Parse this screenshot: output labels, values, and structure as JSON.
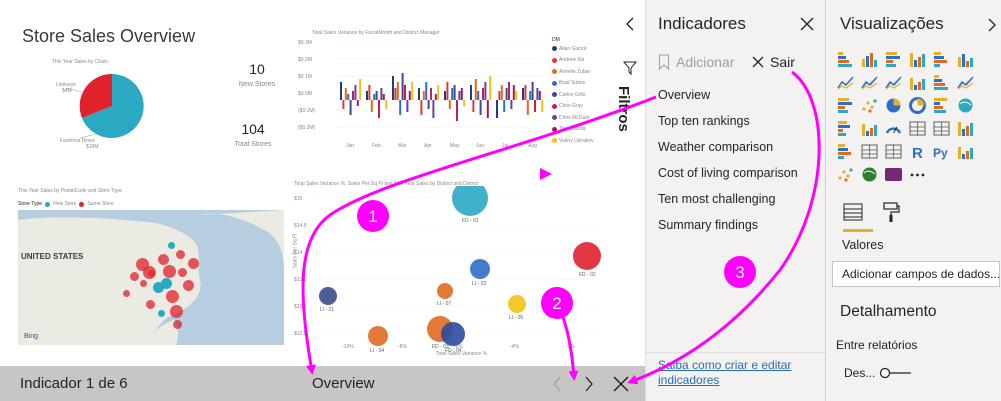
{
  "report": {
    "title": "Store Sales Overview",
    "pie_title": "This Year Sales by Chain",
    "pie_label_a": "Lindseys",
    "pie_label_a_value": "$4M",
    "pie_label_b": "Fashions Direct",
    "pie_label_b_value": "$16M",
    "kpi_new_stores_value": "10",
    "kpi_new_stores_label": "New Stores",
    "kpi_total_stores_value": "104",
    "kpi_total_stores_label": "Total Stores",
    "bar_title": "Total Sales Variance by FiscalMonth and District Manager",
    "bar_y_ticks": [
      "$0.3M",
      "$0.2M",
      "$0.1M",
      "$0.0M",
      "($0.1M)",
      "($0.2M)"
    ],
    "bar_x_ticks": [
      "Jan",
      "Feb",
      "Mar",
      "Apr",
      "May",
      "Jun",
      "Jul",
      "Aug"
    ],
    "legend_header": "DM",
    "legend_items": [
      {
        "name": "Allan Guinot",
        "color": "#1f3d7a"
      },
      {
        "name": "Andrew Ma",
        "color": "#e0393b"
      },
      {
        "name": "Annelie Zubar",
        "color": "#e06a20"
      },
      {
        "name": "Brad Sutton",
        "color": "#2c6fc9"
      },
      {
        "name": "Carlos Grilo",
        "color": "#3f4a8a"
      },
      {
        "name": "Chris Gray",
        "color": "#c41e58"
      },
      {
        "name": "Chris McGurk",
        "color": "#6b3fa0"
      },
      {
        "name": "Tina Lassila",
        "color": "#9b1e5a"
      },
      {
        "name": "Valery Ushakov",
        "color": "#f2c211"
      }
    ],
    "map_title": "This Year Sales by PostalCode and Store Type",
    "map_legend_label": "Store Type",
    "map_legend_new": "New Store",
    "map_legend_same": "Same Store",
    "map_country_label": "UNITED STATES",
    "map_bing": "Bing",
    "scatter_title": "Total Sales Variance %, Sales Per Sq Ft and This Year Sales by District and District",
    "scatter_x_label": "Total Sales Variance %",
    "scatter_y_label": "Sales Per Sq Ft",
    "scatter_y_ticks": [
      "$15",
      "$14.5",
      "$14",
      "$13.5",
      "$13",
      "$12.5"
    ],
    "scatter_x_ticks": [
      "-10%",
      "-8%",
      "-6%",
      "-4%",
      "-2%",
      "0%"
    ],
    "scatter_points": [
      "FD - 01",
      "FD - 02",
      "LI - 03",
      "LI - 07",
      "LI - 01",
      "LI - 05",
      "LI - 04",
      "FD - 03",
      "FD - 04"
    ]
  },
  "bookmark_bar": {
    "counter": "Indicador 1 de 6",
    "current": "Overview"
  },
  "filters": {
    "label": "Filtros"
  },
  "bookmarks_pane": {
    "title": "Indicadores",
    "add_label": "Adicionar",
    "exit_label": "Sair",
    "items": [
      "Overview",
      "Top ten rankings",
      "Weather comparison",
      "Cost of living comparison",
      "Ten most challenging",
      "Summary findings"
    ],
    "learn_link": "Saiba como criar e editar indicadores"
  },
  "viz_pane": {
    "title": "Visualizações",
    "values_label": "Valores",
    "add_fields_placeholder": "Adicionar campos de dados...",
    "drillthrough_title": "Detalhamento",
    "cross_report_label": "Entre relatórios",
    "toggle_label": "Des..."
  },
  "callouts": [
    "1",
    "2",
    "3"
  ],
  "colors": {
    "accent": "#ff00ff",
    "pane_bg": "#f3f2f1",
    "bookmark_bar_bg": "#c8c6c4",
    "link": "#2b6cb0",
    "format_underline": "#e3b128"
  }
}
